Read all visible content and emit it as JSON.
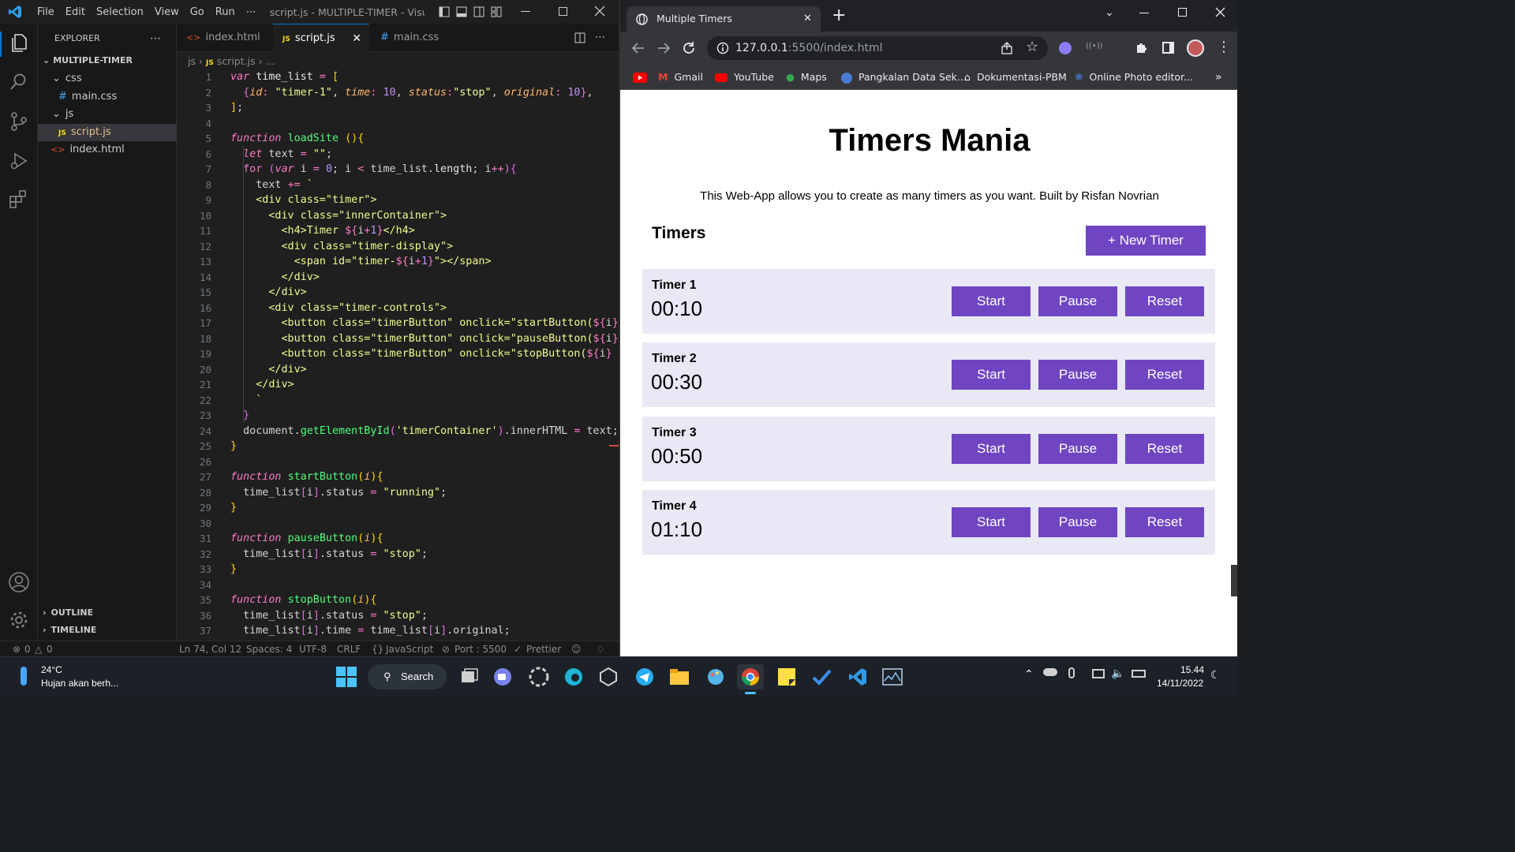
{
  "vscode": {
    "menu": [
      "File",
      "Edit",
      "Selection",
      "View",
      "Go",
      "Run",
      "⋯"
    ],
    "title": "script.js - MULTIPLE-TIMER - Visual...",
    "explorer": {
      "header": "EXPLORER",
      "root": "MULTIPLE-TIMER",
      "items": [
        {
          "label": "css",
          "kind": "folder"
        },
        {
          "label": "main.css",
          "kind": "css"
        },
        {
          "label": "js",
          "kind": "folder"
        },
        {
          "label": "script.js",
          "kind": "js"
        },
        {
          "label": "index.html",
          "kind": "html"
        }
      ],
      "outline": "OUTLINE",
      "timeline": "TIMELINE"
    },
    "tabs": [
      {
        "label": "index.html",
        "icon": "html"
      },
      {
        "label": "script.js",
        "icon": "js",
        "active": true
      },
      {
        "label": "main.css",
        "icon": "css"
      }
    ],
    "breadcrumb": [
      "js",
      "script.js",
      "..."
    ],
    "line_numbers": [
      "1",
      "2",
      "3",
      "4",
      "5",
      "6",
      "7",
      "8",
      "9",
      "10",
      "11",
      "12",
      "13",
      "14",
      "15",
      "16",
      "17",
      "18",
      "19",
      "20",
      "21",
      "22",
      "23",
      "24",
      "25",
      "26",
      "27",
      "28",
      "29",
      "30",
      "31",
      "32",
      "33",
      "34",
      "35",
      "36",
      "37"
    ],
    "status": {
      "errors": "0",
      "warnings": "0",
      "position": "Ln 74, Col 12",
      "spaces": "Spaces: 4",
      "encoding": "UTF-8",
      "eol": "CRLF",
      "language": "JavaScript",
      "port": "Port : 5500",
      "prettier": "Prettier"
    }
  },
  "browser": {
    "tab_title": "Multiple Timers",
    "url_host": "127.0.0.1",
    "url_rest": ":5500/index.html",
    "bookmarks": [
      "Gmail",
      "YouTube",
      "Maps",
      "Pangkalan Data Sek...",
      "Dokumentasi-PBM",
      "Online Photo editor..."
    ],
    "more": "»"
  },
  "page": {
    "heading": "Timers Mania",
    "subtitle": "This Web-App allows you to create as many timers as you want. Built by Risfan Novrian",
    "section_title": "Timers",
    "new_timer_label": "+ New Timer",
    "start_label": "Start",
    "pause_label": "Pause",
    "reset_label": "Reset",
    "timers": [
      {
        "name": "Timer 1",
        "time": "00:10"
      },
      {
        "name": "Timer 2",
        "time": "00:30"
      },
      {
        "name": "Timer 3",
        "time": "00:50"
      },
      {
        "name": "Timer 4",
        "time": "01:10"
      }
    ]
  },
  "taskbar": {
    "weather_temp": "24°C",
    "weather_desc": "Hujan akan berh...",
    "search_label": "Search",
    "time": "15.44",
    "date": "14/11/2022"
  },
  "colors": {
    "accent_purple": "#6f45c2",
    "timer_card_bg": "#e8e9f4",
    "vscode_accent": "#0078d4"
  }
}
